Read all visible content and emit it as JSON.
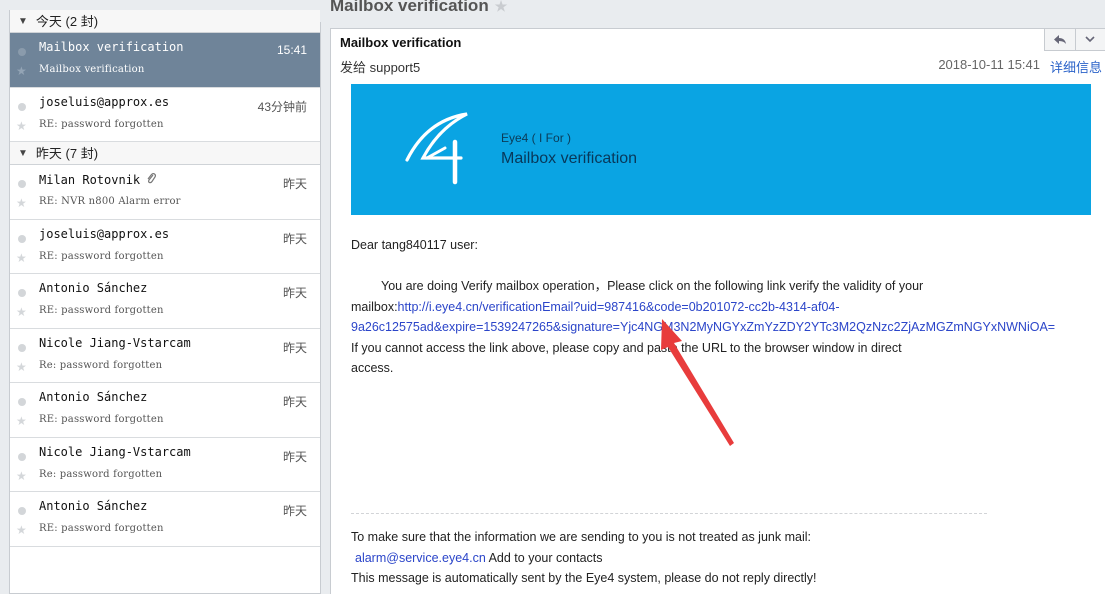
{
  "sidebar": {
    "groups": [
      {
        "label": "今天 (2 封)",
        "items": [
          {
            "sender": "Mailbox verification",
            "subject": "Mailbox verification",
            "time": "15:41",
            "selected": true
          },
          {
            "sender": "joseluis@approx.es",
            "subject": "RE: password forgotten",
            "time": "43分钟前"
          }
        ]
      },
      {
        "label": "昨天 (7 封)",
        "items": [
          {
            "sender": "Milan Rotovnik",
            "subject": "RE: NVR n800 Alarm error",
            "time": "昨天",
            "attachment": true
          },
          {
            "sender": "joseluis@approx.es",
            "subject": "RE: password forgotten",
            "time": "昨天"
          },
          {
            "sender": "Antonio Sánchez",
            "subject": "RE: password forgotten",
            "time": "昨天"
          },
          {
            "sender": "Nicole Jiang-Vstarcam",
            "subject": "Re: password forgotten",
            "time": "昨天"
          },
          {
            "sender": "Antonio Sánchez",
            "subject": "RE: password forgotten",
            "time": "昨天"
          },
          {
            "sender": "Nicole Jiang-Vstarcam",
            "subject": "Re: password forgotten",
            "time": "昨天"
          },
          {
            "sender": "Antonio Sánchez",
            "subject": "RE: password forgotten",
            "time": "昨天"
          }
        ]
      }
    ]
  },
  "pane": {
    "title": "Mailbox verification"
  },
  "message": {
    "subject": "Mailbox verification",
    "to": "发给 support5",
    "date": "2018-10-11 15:41",
    "details_link": "详细信息",
    "banner": {
      "brand": "Eye4 ( I For )",
      "title": "Mailbox verification"
    },
    "greeting": "Dear tang840117 user:",
    "instruction": "You are doing Verify mailbox operation，Please click on the following link verify the validity of your",
    "link_prefix": "mailbox:",
    "link_line1": "http://i.eye4.cn/verificationEmail?uid=987416&code=0b201072-cc2b-4314-af04-",
    "link_line2": "9a26c12575ad&expire=1539247265&signature=Yjc4NGM3N2MyNGYxZmYzZDY2YTc3M2QzNzc2ZjAzMGZmNGYxNWNiOA=",
    "fallback1": "If you cannot access the link above, please copy and paste the URL to the browser window in direct",
    "fallback2": "access.",
    "footer1": "To make sure that the information we are sending to you is not treated as junk mail:",
    "footer_email": "alarm@service.eye4.cn",
    "footer_add": " Add to your contacts",
    "footer2": "This message is automatically sent by the Eye4 system, please do not reply directly!"
  },
  "icons": {
    "group_toggle": "triangle-down-icon",
    "unread": "dot-icon",
    "star": "star-icon",
    "attachment": "paperclip-icon",
    "reply": "reply-icon",
    "more": "chevron-down-icon"
  },
  "colors": {
    "selected_row": "#6f8499",
    "banner": "#0aa4e3",
    "link": "#2b45c9"
  }
}
